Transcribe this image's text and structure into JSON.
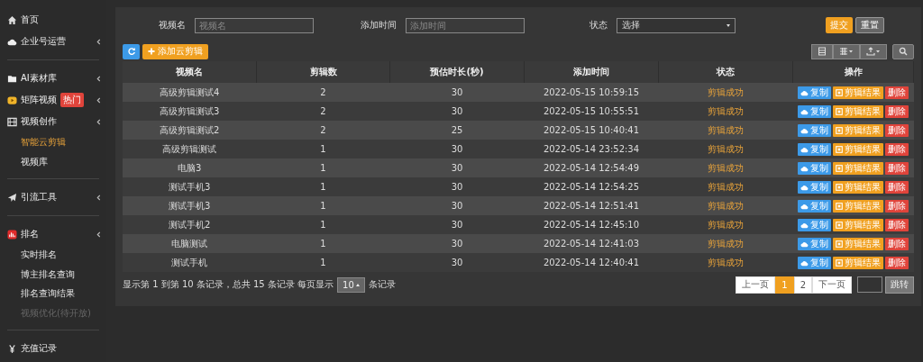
{
  "sidebar": {
    "groups": [
      {
        "items": [
          {
            "label": "首页",
            "expandable": false
          },
          {
            "label": "企业号运营",
            "expandable": true
          }
        ]
      },
      {
        "items": [
          {
            "label": "AI素材库",
            "expandable": true
          },
          {
            "label": "矩阵视频",
            "badge": "热门",
            "expandable": true
          },
          {
            "label": "视频创作",
            "expandable": true,
            "children": [
              {
                "label": "智能云剪辑",
                "selected": true,
                "disabled": false
              },
              {
                "label": "视频库",
                "selected": false,
                "disabled": false
              }
            ]
          }
        ]
      },
      {
        "items": [
          {
            "label": "引流工具",
            "expandable": true
          }
        ]
      },
      {
        "items": [
          {
            "label": "排名",
            "expandable": true,
            "children": [
              {
                "label": "实时排名",
                "selected": false,
                "disabled": false
              },
              {
                "label": "博主排名查询",
                "selected": false,
                "disabled": false
              },
              {
                "label": "排名查询结果",
                "selected": false,
                "disabled": false
              },
              {
                "label": "视频优化(待开放)",
                "selected": false,
                "disabled": true
              }
            ]
          }
        ]
      },
      {
        "items": [
          {
            "label": "充值记录",
            "expandable": false
          }
        ]
      }
    ]
  },
  "filters": [
    {
      "label": "视频名",
      "kind": "text",
      "placeholder": "视频名"
    },
    {
      "label": "添加时间",
      "kind": "text",
      "placeholder": "添加时间"
    },
    {
      "label": "状态",
      "kind": "select",
      "value": "选择"
    }
  ],
  "filter_buttons": [
    {
      "label": "提交",
      "kind": "primary"
    },
    {
      "label": "重置",
      "kind": "default"
    }
  ],
  "add_button": "添加云剪辑",
  "table": {
    "columns": [
      "视频名",
      "剪辑数",
      "预估时长(秒)",
      "添加时间",
      "状态",
      "操作"
    ],
    "rows": [
      {
        "name": "高级剪辑测试4",
        "clips": "2",
        "duration": "30",
        "time": "2022-05-15 10:59:15",
        "status": "剪辑成功",
        "actions": [
          "复制",
          "剪辑结果",
          "删除"
        ]
      },
      {
        "name": "高级剪辑测试3",
        "clips": "2",
        "duration": "30",
        "time": "2022-05-15 10:55:51",
        "status": "剪辑成功",
        "actions": [
          "复制",
          "剪辑结果",
          "删除"
        ]
      },
      {
        "name": "高级剪辑测试2",
        "clips": "2",
        "duration": "25",
        "time": "2022-05-15 10:40:41",
        "status": "剪辑成功",
        "actions": [
          "复制",
          "剪辑结果",
          "删除"
        ]
      },
      {
        "name": "高级剪辑测试",
        "clips": "1",
        "duration": "30",
        "time": "2022-05-14 23:52:34",
        "status": "剪辑成功",
        "actions": [
          "复制",
          "剪辑结果",
          "删除"
        ]
      },
      {
        "name": "电脑3",
        "clips": "1",
        "duration": "30",
        "time": "2022-05-14 12:54:49",
        "status": "剪辑成功",
        "actions": [
          "复制",
          "剪辑结果",
          "删除"
        ]
      },
      {
        "name": "测试手机3",
        "clips": "1",
        "duration": "30",
        "time": "2022-05-14 12:54:25",
        "status": "剪辑成功",
        "actions": [
          "复制",
          "剪辑结果",
          "删除"
        ]
      },
      {
        "name": "测试手机3",
        "clips": "1",
        "duration": "30",
        "time": "2022-05-14 12:51:41",
        "status": "剪辑成功",
        "actions": [
          "复制",
          "剪辑结果",
          "删除"
        ]
      },
      {
        "name": "测试手机2",
        "clips": "1",
        "duration": "30",
        "time": "2022-05-14 12:45:10",
        "status": "剪辑成功",
        "actions": [
          "复制",
          "剪辑结果",
          "删除"
        ]
      },
      {
        "name": "电脑测试",
        "clips": "1",
        "duration": "30",
        "time": "2022-05-14 12:41:03",
        "status": "剪辑成功",
        "actions": [
          "复制",
          "剪辑结果",
          "删除"
        ]
      },
      {
        "name": "测试手机",
        "clips": "1",
        "duration": "30",
        "time": "2022-05-14 12:40:41",
        "status": "剪辑成功",
        "actions": [
          "复制",
          "剪辑结果",
          "删除"
        ]
      }
    ]
  },
  "footer": {
    "info": "显示第 1 到第 10 条记录，总共 15 条记录 每页显示",
    "page_size": "10",
    "suffix": "条记录"
  },
  "pagination": {
    "prev": "上一页",
    "pages": [
      {
        "label": "1",
        "selected": true
      },
      {
        "label": "2",
        "selected": false
      }
    ],
    "next": "下一页",
    "jump": "跳转"
  }
}
